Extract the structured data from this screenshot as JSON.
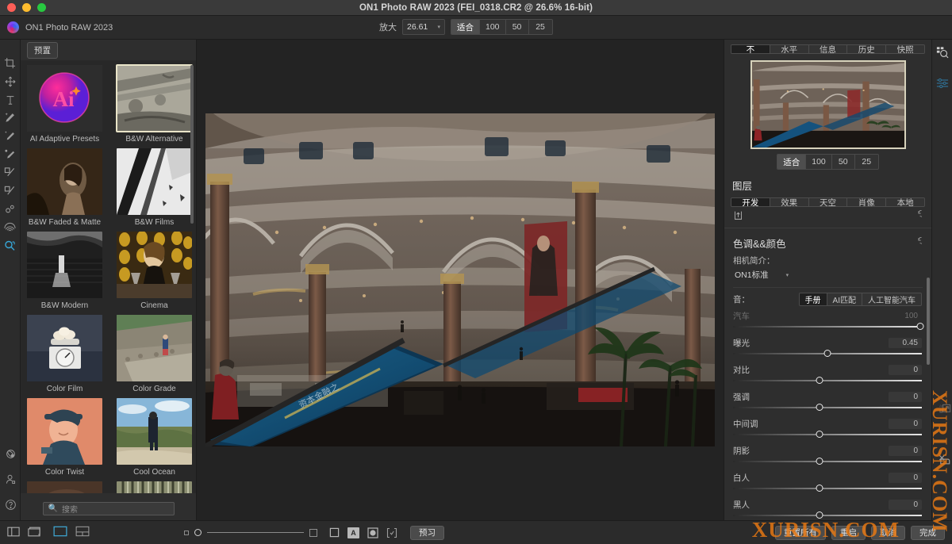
{
  "window": {
    "title": "ON1 Photo RAW 2023 (FEI_0318.CR2 @ 26.6% 16-bit)",
    "traffic_lights": [
      "close",
      "minimize",
      "maximize"
    ]
  },
  "menubar": {
    "brand": "ON1 Photo RAW 2023",
    "zoom_label": "放大",
    "zoom_value": "26.61",
    "fit_label": "适合",
    "zoom_presets": [
      "100",
      "50",
      "25"
    ],
    "active_zoom_preset": "适合"
  },
  "left_rail": {
    "tools": [
      {
        "name": "crop-tool",
        "icon": "crop-icon",
        "active": false
      },
      {
        "name": "move-tool",
        "icon": "move-arrows-icon",
        "active": false
      },
      {
        "name": "text-tool",
        "icon": "text-t-icon",
        "active": false
      },
      {
        "name": "retouch-brush-tool",
        "icon": "magic-wand-icon",
        "active": false
      },
      {
        "name": "healing-brush-tool",
        "icon": "healing-brush-icon",
        "active": false
      },
      {
        "name": "perfect-eraser-tool",
        "icon": "eraser-brush-icon",
        "active": false
      },
      {
        "name": "masking-brush-tool",
        "icon": "mask-brush-icon",
        "active": false
      },
      {
        "name": "adjustable-brush-tool",
        "icon": "adjust-brush-icon",
        "active": false
      },
      {
        "name": "blemish-remover-tool",
        "icon": "circles-icon",
        "active": false
      },
      {
        "name": "portrait-tool",
        "icon": "fingerprint-icon",
        "active": false
      },
      {
        "name": "zoom-tool",
        "icon": "magnifier-hand-icon",
        "active": true
      }
    ],
    "bottom_tools": [
      {
        "name": "atom-icon"
      },
      {
        "name": "person-icon"
      },
      {
        "name": "help-question-icon"
      }
    ]
  },
  "presets": {
    "tab_label": "预置",
    "search_placeholder": "搜索",
    "search_value": "",
    "search_icon": "search-icon",
    "items": [
      {
        "label": "AI Adaptive Presets",
        "kind": "ai-logo",
        "selected": false
      },
      {
        "label": "B&W Alternative",
        "kind": "bw-architecture",
        "selected": true
      },
      {
        "label": "B&W Faded & Matte",
        "kind": "sepia-portrait",
        "selected": false
      },
      {
        "label": "B&W Films",
        "kind": "bw-highkey",
        "selected": false
      },
      {
        "label": "B&W Modern",
        "kind": "bw-landscape",
        "selected": false
      },
      {
        "label": "Cinema",
        "kind": "cinema-portrait",
        "selected": false
      },
      {
        "label": "Color Film",
        "kind": "scale-stilllife",
        "selected": false
      },
      {
        "label": "Color Grade",
        "kind": "stone-path",
        "selected": false
      },
      {
        "label": "Color Twist",
        "kind": "orange-portrait",
        "selected": false
      },
      {
        "label": "Cool Ocean",
        "kind": "dune-figure",
        "selected": false
      },
      {
        "label": "",
        "kind": "dark-warm",
        "selected": false
      },
      {
        "label": "",
        "kind": "forest-trees",
        "selected": false
      }
    ]
  },
  "canvas": {
    "photo_alt": "Shopping mall atrium interior with ornate columns, arches, escalators and blue banners"
  },
  "right_panel": {
    "top_tabs": [
      {
        "label": "不",
        "active": true
      },
      {
        "label": "水平",
        "active": false
      },
      {
        "label": "信息",
        "active": false
      },
      {
        "label": "历史",
        "active": false
      },
      {
        "label": "快照",
        "active": false
      }
    ],
    "nav_zoom": {
      "fit_label": "适合",
      "presets": [
        "100",
        "50",
        "25"
      ],
      "active": "适合"
    },
    "layers_title": "图层",
    "module_tabs": [
      {
        "label": "开发",
        "active": true
      },
      {
        "label": "效果",
        "active": false
      },
      {
        "label": "天空",
        "active": false
      },
      {
        "label": "肖像",
        "active": false
      },
      {
        "label": "本地",
        "active": false
      }
    ],
    "toolbar_icons": [
      {
        "name": "export-icon"
      },
      {
        "name": "reset-arrow-icon"
      }
    ],
    "section": {
      "title": "色调&&颜色",
      "reset_icon": "reset-arrow-icon",
      "profile_label": "相机简介：",
      "profile_value": "ON1标准",
      "profile_caret": "chevron-down-icon",
      "tone_label": "音：",
      "tone_modes": [
        {
          "label": "手册",
          "active": true
        },
        {
          "label": "AI匹配",
          "active": false
        },
        {
          "label": "人工智能汽车",
          "active": false
        }
      ]
    },
    "sliders": [
      {
        "name": "汽车",
        "value": "100",
        "pos": 100,
        "disabled": true
      },
      {
        "name": "曝光",
        "value": "0.45",
        "pos": 50,
        "disabled": false
      },
      {
        "name": "对比",
        "value": "0",
        "pos": 46,
        "disabled": false
      },
      {
        "name": "强调",
        "value": "0",
        "pos": 46,
        "disabled": false
      },
      {
        "name": "中间调",
        "value": "0",
        "pos": 46,
        "disabled": false
      },
      {
        "name": "阴影",
        "value": "0",
        "pos": 46,
        "disabled": false
      },
      {
        "name": "白人",
        "value": "0",
        "pos": 46,
        "disabled": false
      },
      {
        "name": "黑人",
        "value": "0",
        "pos": 46,
        "disabled": false
      }
    ]
  },
  "far_rail": {
    "tools": [
      {
        "name": "browse-search-icon"
      },
      {
        "name": "sliders-settings-icon"
      },
      {
        "name": "ai-resize-icon"
      },
      {
        "name": "no-print-icon"
      }
    ]
  },
  "bottom_bar": {
    "view_icons": [
      {
        "name": "show-left-panel-icon",
        "active": false
      },
      {
        "name": "show-filmstrip-icon",
        "active": false
      },
      {
        "name": "single-view-icon",
        "active": true
      },
      {
        "name": "compare-view-icon",
        "active": false
      }
    ],
    "thumb_slider": {
      "small_icon": "small-square-icon",
      "large_icon": "large-square-icon",
      "position": 10
    },
    "toggle_icons": [
      {
        "name": "soft-proof-icon",
        "label": ""
      },
      {
        "name": "letter-a-icon",
        "label": "A"
      },
      {
        "name": "clipping-circle-icon",
        "label": ""
      },
      {
        "name": "compare-brackets-icon",
        "label": ""
      }
    ],
    "preview_button": "预习",
    "right_buttons": [
      "重置所有",
      "重启",
      "取消",
      "完成"
    ]
  },
  "watermark": {
    "vertical": "XURISN.COM",
    "horizontal": "XURISN.COM"
  },
  "colors": {
    "accent": "#37a7d8",
    "window_bg": "#2b2b2b",
    "panel_bg": "#2e2e2e",
    "canvas_bg": "#232323",
    "selection": "#e9e4c8",
    "watermark": "#ec7a12"
  }
}
